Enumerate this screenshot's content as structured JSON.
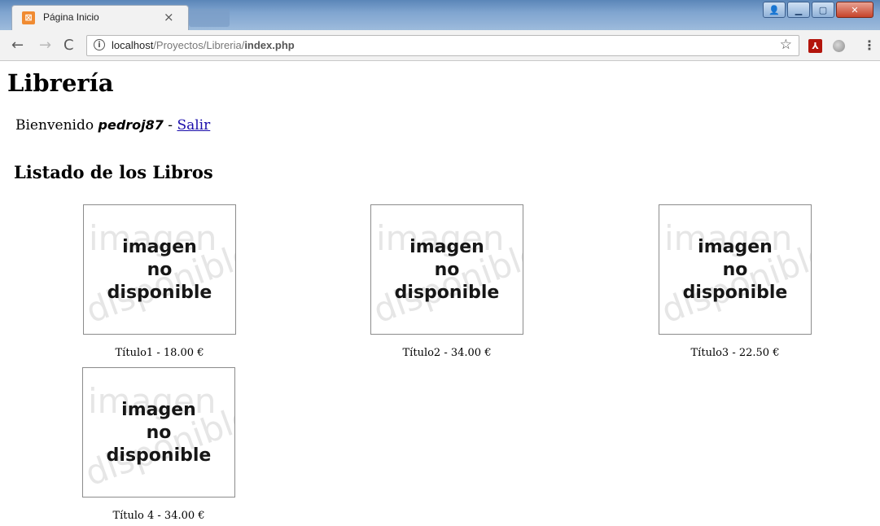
{
  "browser": {
    "tab": {
      "title": "Página Inicio",
      "close": "×",
      "favicon": "xampp-icon"
    },
    "url": {
      "host": "localhost",
      "path": "/Proyectos/Libreria/",
      "file": "index.php"
    }
  },
  "page": {
    "title": "Librería",
    "welcome": {
      "prefix": "Bienvenido ",
      "user": "pedroj87",
      "separator": " - ",
      "logout": "Salir"
    },
    "section_title": "Listado de los Libros",
    "placeholder": {
      "line1": "imagen",
      "line2": "no",
      "line3": "disponible",
      "watermark1": "imagen",
      "watermark2": "disponible"
    },
    "books": [
      {
        "caption": "Título1 - 18.00 €"
      },
      {
        "caption": "Título2 - 34.00 €"
      },
      {
        "caption": "Título3 - 22.50 €"
      },
      {
        "caption": "Título 4 - 34.00 €"
      }
    ]
  }
}
